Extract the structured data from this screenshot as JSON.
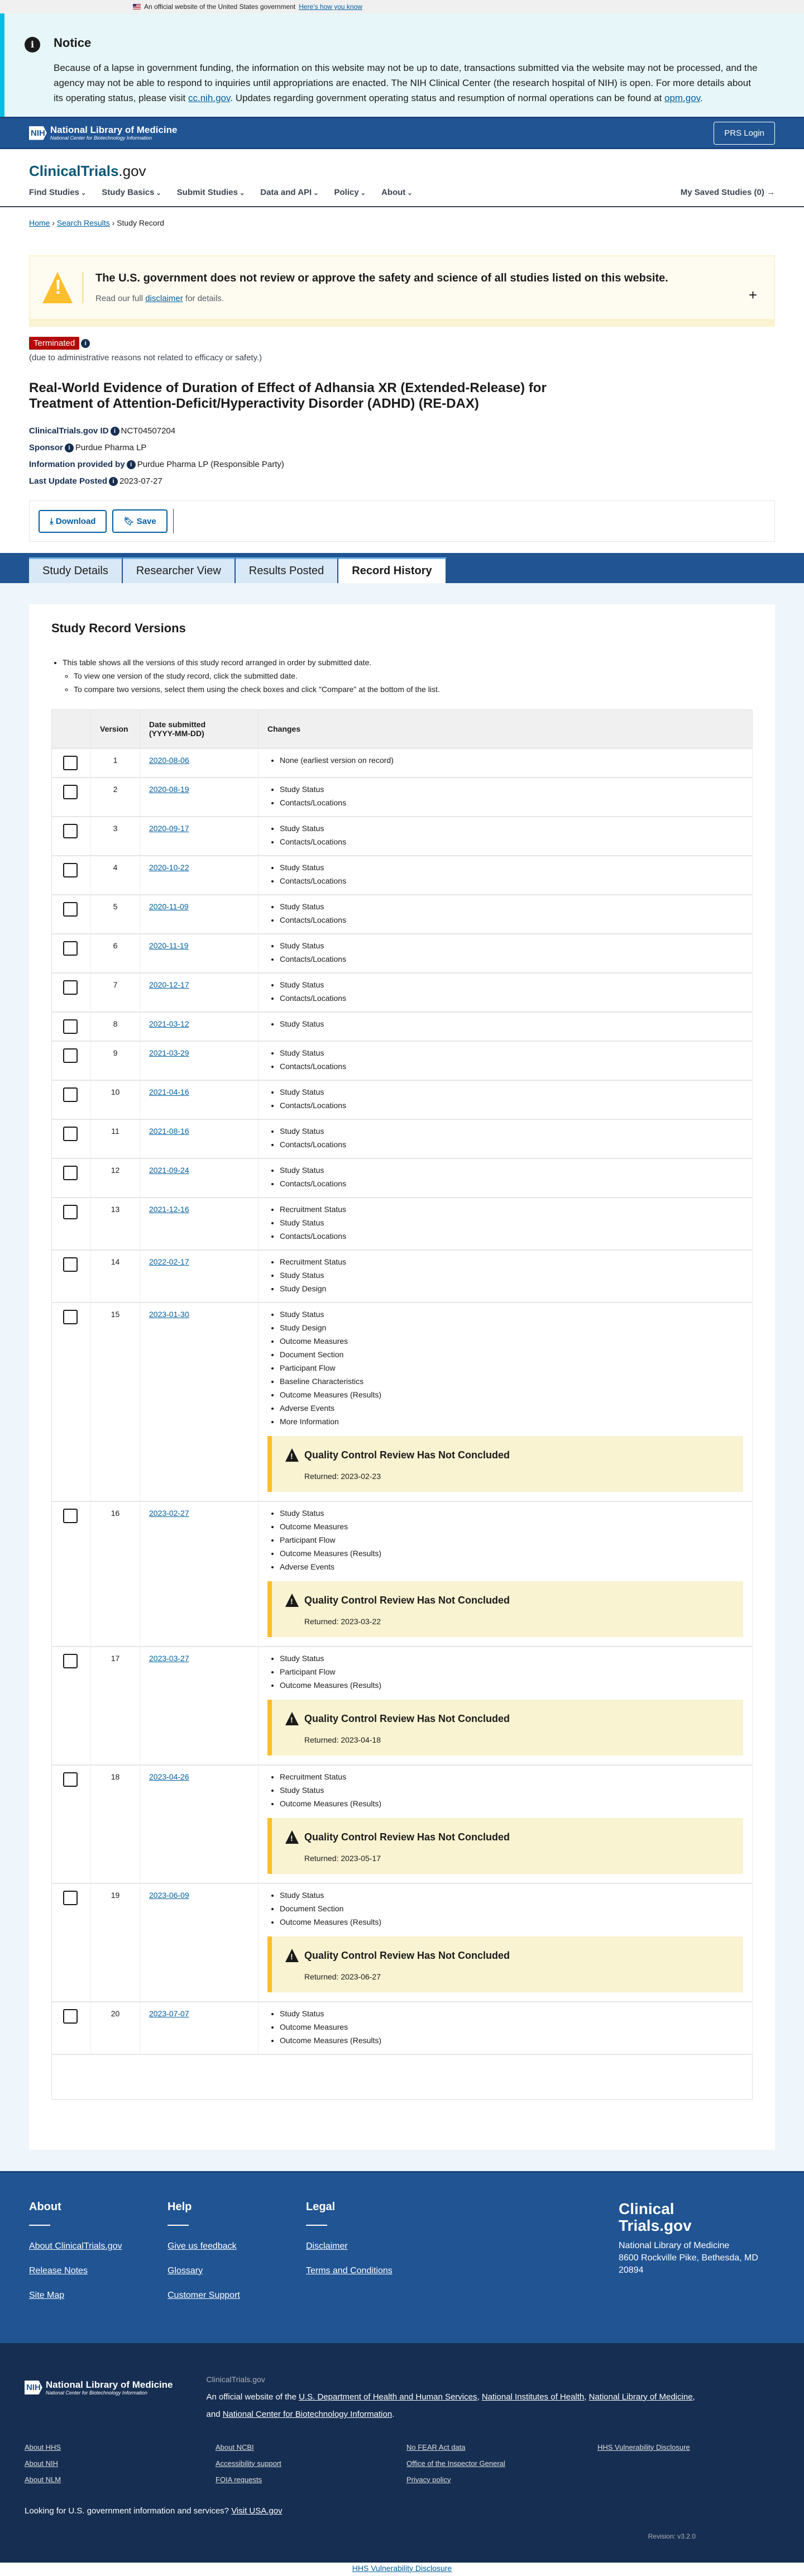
{
  "govbanner": {
    "text": "An official website of the United States government",
    "link": "Here's how you know"
  },
  "notice": {
    "title": "Notice",
    "text1": "Because of a lapse in government funding, the information on this website may not be up to date, transactions submitted via the website may not be processed, and the agency may not be able to respond to inquiries until appropriations are enacted. The NIH Clinical Center (the research hospital of NIH) is open. For more details about its operating status, please visit ",
    "link1": "cc.nih.gov",
    "text2": ". Updates regarding government operating status and resumption of normal operations can be found at ",
    "link2": "opm.gov",
    "text3": "."
  },
  "nlm": {
    "nih": "NIH",
    "name": "National Library of Medicine",
    "sub": "National Center for Biotechnology Information",
    "login": "PRS Login"
  },
  "brand": {
    "name": "ClinicalTrials",
    "suffix": ".gov"
  },
  "menu": {
    "items": [
      "Find Studies",
      "Study Basics",
      "Submit Studies",
      "Data and API",
      "Policy",
      "About"
    ],
    "saved": "My Saved Studies (0) →"
  },
  "breadcrumb": {
    "home": "Home",
    "search": "Search Results",
    "current": "Study Record"
  },
  "disclaimer": {
    "title": "The U.S. government does not review or approve the safety and science of all studies listed on this website.",
    "pre": "Read our full ",
    "link": "disclaimer",
    "post": " for details.",
    "expand": "+"
  },
  "study": {
    "status": "Terminated",
    "reason": "(due to administrative reasons not related to efficacy or safety.)",
    "title": "Real-World Evidence of Duration of Effect of Adhansia XR (Extended-Release) for Treatment of Attention-Deficit/Hyperactivity Disorder (ADHD) (RE-DAX)",
    "id_label": "ClinicalTrials.gov ID",
    "id": "NCT04507204",
    "sponsor_label": "Sponsor",
    "sponsor": "Purdue Pharma LP",
    "provided_label": "Information provided by",
    "provided": "Purdue Pharma LP (Responsible Party)",
    "updated_label": "Last Update Posted",
    "updated": "2023-07-27"
  },
  "actions": {
    "download": "Download",
    "save": "Save"
  },
  "tabs": [
    "Study Details",
    "Researcher View",
    "Results Posted",
    "Record History"
  ],
  "history": {
    "title": "Study Record Versions",
    "intro": "This table shows all the versions of this study record arranged in order by submitted date.",
    "sub1": "To view one version of the study record, click the submitted date.",
    "sub2": "To compare two versions, select them using the check boxes and click \"Compare\" at the bottom of the list.",
    "col_version": "Version",
    "col_date": "Date submitted",
    "col_date_fmt": "(YYYY-MM-DD)",
    "col_changes": "Changes",
    "versions": [
      {
        "v": "1",
        "date": "2020-08-06",
        "changes": [
          "None (earliest version on record)"
        ]
      },
      {
        "v": "2",
        "date": "2020-08-19",
        "changes": [
          "Study Status",
          "Contacts/Locations"
        ]
      },
      {
        "v": "3",
        "date": "2020-09-17",
        "changes": [
          "Study Status",
          "Contacts/Locations"
        ]
      },
      {
        "v": "4",
        "date": "2020-10-22",
        "changes": [
          "Study Status",
          "Contacts/Locations"
        ]
      },
      {
        "v": "5",
        "date": "2020-11-09",
        "changes": [
          "Study Status",
          "Contacts/Locations"
        ]
      },
      {
        "v": "6",
        "date": "2020-11-19",
        "changes": [
          "Study Status",
          "Contacts/Locations"
        ]
      },
      {
        "v": "7",
        "date": "2020-12-17",
        "changes": [
          "Study Status",
          "Contacts/Locations"
        ]
      },
      {
        "v": "8",
        "date": "2021-03-12",
        "changes": [
          "Study Status"
        ]
      },
      {
        "v": "9",
        "date": "2021-03-29",
        "changes": [
          "Study Status",
          "Contacts/Locations"
        ]
      },
      {
        "v": "10",
        "date": "2021-04-16",
        "changes": [
          "Study Status",
          "Contacts/Locations"
        ]
      },
      {
        "v": "11",
        "date": "2021-08-16",
        "changes": [
          "Study Status",
          "Contacts/Locations"
        ]
      },
      {
        "v": "12",
        "date": "2021-09-24",
        "changes": [
          "Study Status",
          "Contacts/Locations"
        ]
      },
      {
        "v": "13",
        "date": "2021-12-16",
        "changes": [
          "Recruitment Status",
          "Study Status",
          "Contacts/Locations"
        ]
      },
      {
        "v": "14",
        "date": "2022-02-17",
        "changes": [
          "Recruitment Status",
          "Study Status",
          "Study Design"
        ]
      },
      {
        "v": "15",
        "date": "2023-01-30",
        "changes": [
          "Study Status",
          "Study Design",
          "Outcome Measures",
          "Document Section",
          "Participant Flow",
          "Baseline Characteristics",
          "Outcome Measures (Results)",
          "Adverse Events",
          "More Information"
        ],
        "qc": {
          "title": "Quality Control Review Has Not Concluded",
          "returned": "Returned: 2023-02-23"
        }
      },
      {
        "v": "16",
        "date": "2023-02-27",
        "changes": [
          "Study Status",
          "Outcome Measures",
          "Participant Flow",
          "Outcome Measures (Results)",
          "Adverse Events"
        ],
        "qc": {
          "title": "Quality Control Review Has Not Concluded",
          "returned": "Returned: 2023-03-22"
        }
      },
      {
        "v": "17",
        "date": "2023-03-27",
        "changes": [
          "Study Status",
          "Participant Flow",
          "Outcome Measures (Results)"
        ],
        "qc": {
          "title": "Quality Control Review Has Not Concluded",
          "returned": "Returned: 2023-04-18"
        }
      },
      {
        "v": "18",
        "date": "2023-04-26",
        "changes": [
          "Recruitment Status",
          "Study Status",
          "Outcome Measures (Results)"
        ],
        "qc": {
          "title": "Quality Control Review Has Not Concluded",
          "returned": "Returned: 2023-05-17"
        }
      },
      {
        "v": "19",
        "date": "2023-06-09",
        "changes": [
          "Study Status",
          "Document Section",
          "Outcome Measures (Results)"
        ],
        "qc": {
          "title": "Quality Control Review Has Not Concluded",
          "returned": "Returned: 2023-06-27"
        }
      },
      {
        "v": "20",
        "date": "2023-07-07",
        "changes": [
          "Study Status",
          "Outcome Measures",
          "Outcome Measures (Results)"
        ]
      }
    ]
  },
  "footer": {
    "cols": [
      {
        "title": "About",
        "links": [
          "About ClinicalTrials.gov",
          "Release Notes",
          "Site Map"
        ]
      },
      {
        "title": "Help",
        "links": [
          "Give us feedback",
          "Glossary",
          "Customer Support"
        ]
      },
      {
        "title": "Legal",
        "links": [
          "Disclaimer",
          "Terms and Conditions"
        ]
      }
    ],
    "logo1": "Clinical",
    "logo2": "Trials.gov",
    "addr1": "National Library of Medicine",
    "addr2": "8600 Rockville Pike, Bethesda, MD",
    "addr3": "20894",
    "site": "ClinicalTrials.gov",
    "official": "An official website of the ",
    "hhs": "U.S. Department of Health and Human Services",
    "nih": "National Institutes of Health",
    "nlm": "National Library of Medicine",
    "and": "and ",
    "ncbi": "National Center for Biotechnology Information",
    "links": [
      "About HHS",
      "About NCBI",
      "No FEAR Act data",
      "HHS Vulnerability Disclosure",
      "About NIH",
      "Accessibility support",
      "Office of the Inspector General",
      "",
      "About NLM",
      "FOIA requests",
      "Privacy policy",
      ""
    ],
    "usa_text": "Looking for U.S. government information and services?",
    "usa_link": "Visit USA.gov",
    "revision": "Revision: v3.2.0",
    "bottom": "HHS Vulnerability Disclosure"
  }
}
